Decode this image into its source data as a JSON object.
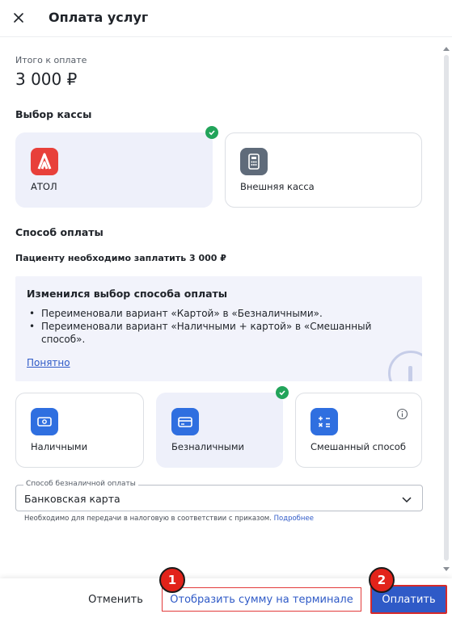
{
  "header": {
    "title": "Оплата услуг",
    "close_icon": "close-icon"
  },
  "total": {
    "label": "Итого к оплате",
    "value": "3 000 ₽"
  },
  "cash_register": {
    "section_title": "Выбор кассы",
    "options": [
      {
        "label": "АТОЛ",
        "icon": "atol-logo-icon",
        "icon_color": "#e8403a",
        "selected": true
      },
      {
        "label": "Внешняя касса",
        "icon": "register-icon",
        "icon_color": "#5f6b7a",
        "selected": false
      }
    ]
  },
  "payment": {
    "section_title": "Способ оплаты",
    "subtitle": "Пациенту необходимо заплатить 3 000 ₽",
    "notice": {
      "title": "Изменился выбор способа оплаты",
      "items": [
        "Переименовали вариант «Картой» в «Безналичными».",
        "Переименовали вариант «Наличными + картой» в «Смешанный способ»."
      ],
      "link": "Понятно"
    },
    "methods": [
      {
        "label": "Наличными",
        "icon": "cash-icon",
        "selected": false
      },
      {
        "label": "Безналичными",
        "icon": "card-icon",
        "selected": true
      },
      {
        "label": "Смешанный способ",
        "icon": "calculator-icon",
        "selected": false
      }
    ],
    "method_icon_color": "#2f6fe0",
    "cashless_select": {
      "legend": "Способ безналичной оплаты",
      "value": "Банковская карта"
    },
    "hint": "Необходимо для передачи в налоговую в соответствии с приказом.",
    "hint_link": "Подробнее"
  },
  "footer": {
    "cancel_label": "Отменить",
    "terminal_label": "Отобразить сумму на терминале",
    "pay_label": "Оплатить",
    "badge_1": "1",
    "badge_2": "2"
  },
  "colors": {
    "accent": "#2f5ac7",
    "success": "#22a45a",
    "highlight": "#e2231a"
  }
}
